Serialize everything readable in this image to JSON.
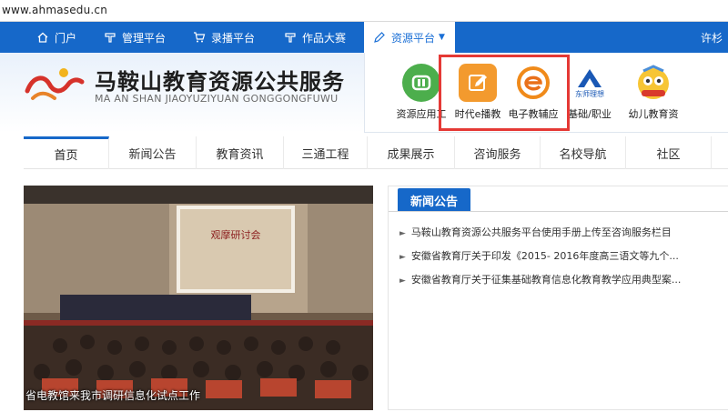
{
  "url": "www.ahmasedu.cn",
  "topnav": {
    "items": [
      {
        "label": "门户",
        "icon": "home-icon"
      },
      {
        "label": "管理平台",
        "icon": "dryer-icon"
      },
      {
        "label": "录播平台",
        "icon": "cart-icon"
      },
      {
        "label": "作品大赛",
        "icon": "dryer-icon"
      },
      {
        "label": "资源平台",
        "icon": "pen-icon"
      }
    ],
    "right_label": "许杉"
  },
  "header": {
    "title": "马鞍山教育资源公共服务",
    "subtitle": "MA AN SHAN JIAOYUZIYUAN GONGGONGFUWU"
  },
  "dropdown": {
    "apps": [
      {
        "label": "资源应用工",
        "icon": "resource-app-icon"
      },
      {
        "label": "时代e播教",
        "icon": "edit-icon"
      },
      {
        "label": "电子教辅应",
        "icon": "e-icon"
      },
      {
        "label": "东师理想",
        "icon": "dongshi-logo-icon"
      },
      {
        "label": "基础/职业",
        "icon": ""
      },
      {
        "label": "幼儿教育资",
        "icon": "cartoon-icon"
      }
    ]
  },
  "mainnav": {
    "tabs": [
      "首页",
      "新闻公告",
      "教育资讯",
      "三通工程",
      "成果展示",
      "咨询服务",
      "名校导航",
      "社区"
    ]
  },
  "photo": {
    "caption": "省电教馆来我市调研信息化试点工作",
    "screen_title": "观摩研讨会"
  },
  "news": {
    "heading": "新闻公告",
    "items": [
      "马鞍山教育资源公共服务平台使用手册上传至咨询服务栏目",
      "安徽省教育厅关于印发《2015- 2016年度高三语文等九个...",
      "安徽省教育厅关于征集基础教育信息化教育教学应用典型案..."
    ]
  },
  "colors": {
    "nav_blue": "#1668c9",
    "highlight_red": "#e53935"
  }
}
